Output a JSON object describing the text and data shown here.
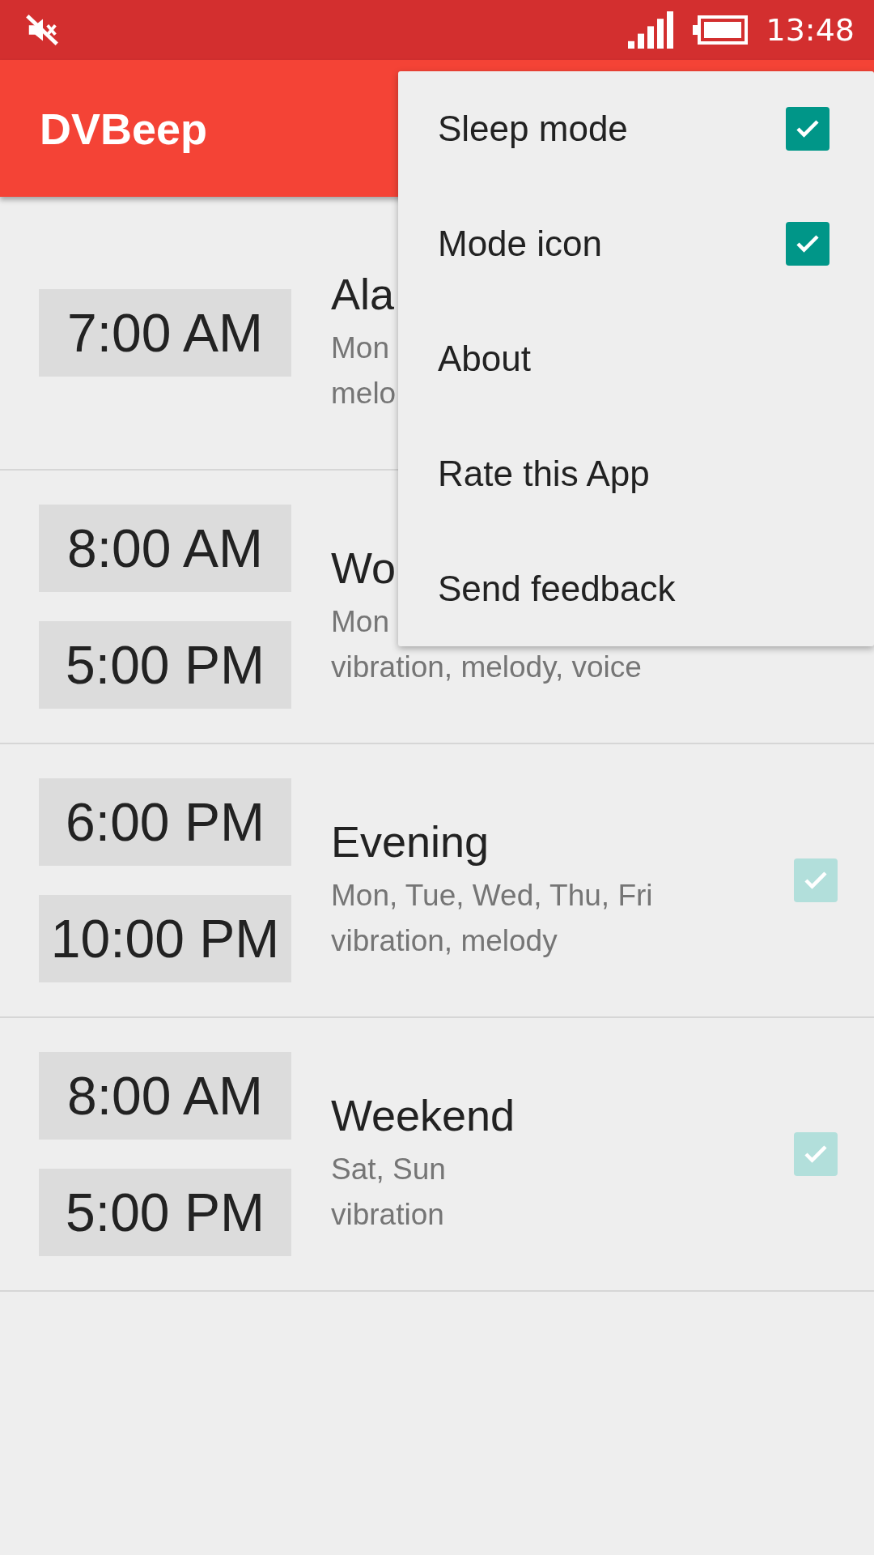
{
  "status_bar": {
    "muted": true,
    "time": "13:48"
  },
  "app_bar": {
    "title": "DVBeep"
  },
  "alarms": [
    {
      "times": [
        "7:00 AM"
      ],
      "title": "Ala",
      "lines": [
        "Mon",
        "melo"
      ]
    },
    {
      "times": [
        "8:00 AM",
        "5:00 PM"
      ],
      "title": "Wo",
      "lines": [
        "Mon",
        "vibration, melody, voice"
      ]
    },
    {
      "times": [
        "6:00 PM",
        "10:00 PM"
      ],
      "title": "Evening",
      "lines": [
        "Mon, Tue, Wed, Thu, Fri",
        "vibration, melody"
      ],
      "checked": true,
      "disabled": true
    },
    {
      "times": [
        "8:00 AM",
        "5:00 PM"
      ],
      "title": "Weekend",
      "lines": [
        "Sat, Sun",
        "vibration"
      ],
      "checked": true,
      "disabled": true
    }
  ],
  "menu": {
    "items": [
      {
        "label": "Sleep mode",
        "kind": "check",
        "checked": true
      },
      {
        "label": "Mode icon",
        "kind": "check",
        "checked": true
      },
      {
        "label": "About",
        "kind": "plain"
      },
      {
        "label": "Rate this App",
        "kind": "plain"
      },
      {
        "label": "Send feedback",
        "kind": "plain"
      }
    ]
  }
}
